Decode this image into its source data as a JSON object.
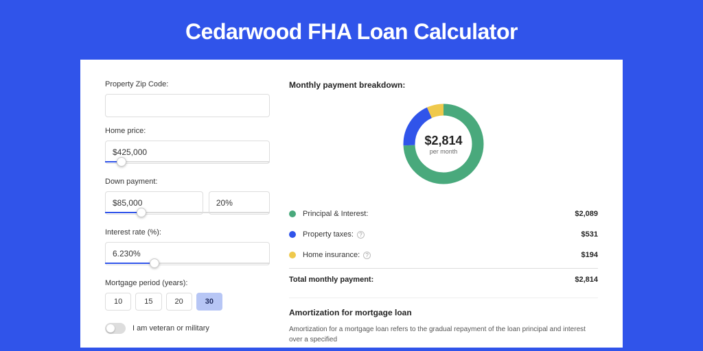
{
  "title": "Cedarwood FHA Loan Calculator",
  "form": {
    "zip_label": "Property Zip Code:",
    "zip_value": "",
    "price_label": "Home price:",
    "price_value": "$425,000",
    "price_slider_pct": 10,
    "down_label": "Down payment:",
    "down_value": "$85,000",
    "down_pct_value": "20%",
    "down_slider_pct": 22,
    "rate_label": "Interest rate (%):",
    "rate_value": "6.230%",
    "rate_slider_pct": 30,
    "period_label": "Mortgage period (years):",
    "periods": [
      "10",
      "15",
      "20",
      "30"
    ],
    "period_active_index": 3,
    "vet_label": "I am veteran or military"
  },
  "breakdown": {
    "heading": "Monthly payment breakdown:",
    "center_value": "$2,814",
    "center_sub": "per month",
    "items": [
      {
        "label": "Principal & Interest:",
        "value": "$2,089",
        "color": "#49a97c",
        "help": false
      },
      {
        "label": "Property taxes:",
        "value": "$531",
        "color": "#3054ea",
        "help": true
      },
      {
        "label": "Home insurance:",
        "value": "$194",
        "color": "#efc94c",
        "help": true
      }
    ],
    "total_label": "Total monthly payment:",
    "total_value": "$2,814"
  },
  "amort": {
    "heading": "Amortization for mortgage loan",
    "text": "Amortization for a mortgage loan refers to the gradual repayment of the loan principal and interest over a specified"
  },
  "chart_data": {
    "type": "pie",
    "title": "Monthly payment breakdown",
    "series": [
      {
        "name": "Principal & Interest",
        "value": 2089,
        "color": "#49a97c"
      },
      {
        "name": "Property taxes",
        "value": 531,
        "color": "#3054ea"
      },
      {
        "name": "Home insurance",
        "value": 194,
        "color": "#efc94c"
      }
    ],
    "total": 2814,
    "center_label": "$2,814 per month"
  }
}
